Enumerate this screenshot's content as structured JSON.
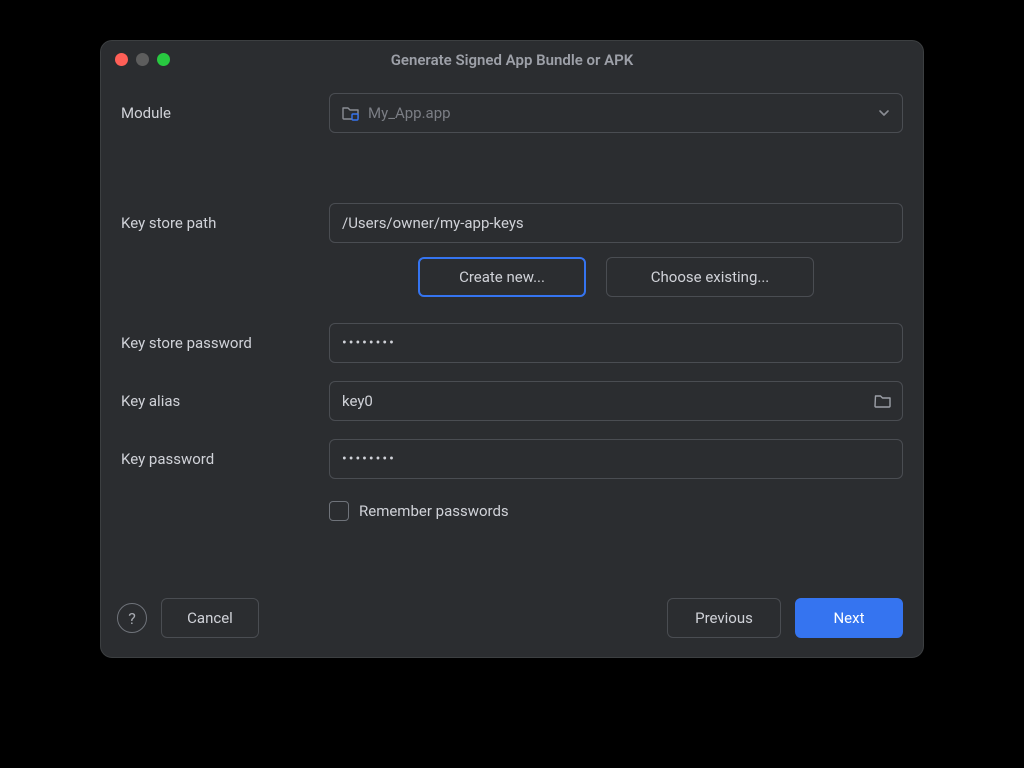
{
  "dialog": {
    "title": "Generate Signed App Bundle or APK"
  },
  "labels": {
    "module": "Module",
    "key_store_path": "Key store path",
    "key_store_password": "Key store password",
    "key_alias": "Key alias",
    "key_password": "Key password",
    "remember": "Remember passwords"
  },
  "fields": {
    "module_value": "My_App.app",
    "key_store_path_value": "/Users/owner/my-app-keys",
    "key_store_password_value": "••••••••",
    "key_alias_value": "key0",
    "key_password_value": "••••••••"
  },
  "buttons": {
    "create_new": "Create new...",
    "choose_existing": "Choose existing...",
    "help": "?",
    "cancel": "Cancel",
    "previous": "Previous",
    "next": "Next"
  }
}
